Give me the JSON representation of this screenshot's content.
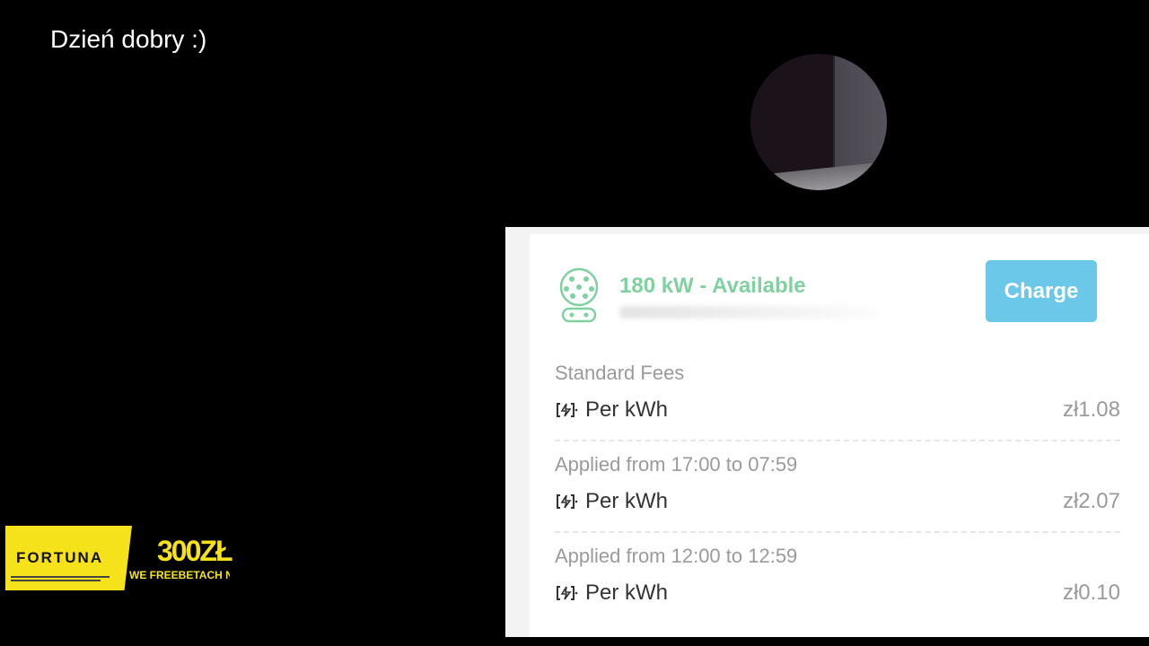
{
  "greeting": "Dzień dobry :)",
  "station": {
    "status": "180 kW - Available",
    "icon": "ccs-connector-icon",
    "charge_button": "Charge",
    "accent_color": "#7fd1a0",
    "button_color": "#6cc8e8"
  },
  "fees": [
    {
      "title": "Standard Fees",
      "label": "Per kWh",
      "price": "zł1.08"
    },
    {
      "title": "Applied from 17:00 to 07:59",
      "label": "Per kWh",
      "price": "zł2.07"
    },
    {
      "title": "Applied from 12:00 to 12:59",
      "label": "Per kWh",
      "price": "zł0.10"
    }
  ],
  "ad": {
    "brand": "FORTUNA",
    "amount": "300ZŁ",
    "subtitle": "WE FREEBETACH NA G",
    "color": "#f5e21a"
  }
}
